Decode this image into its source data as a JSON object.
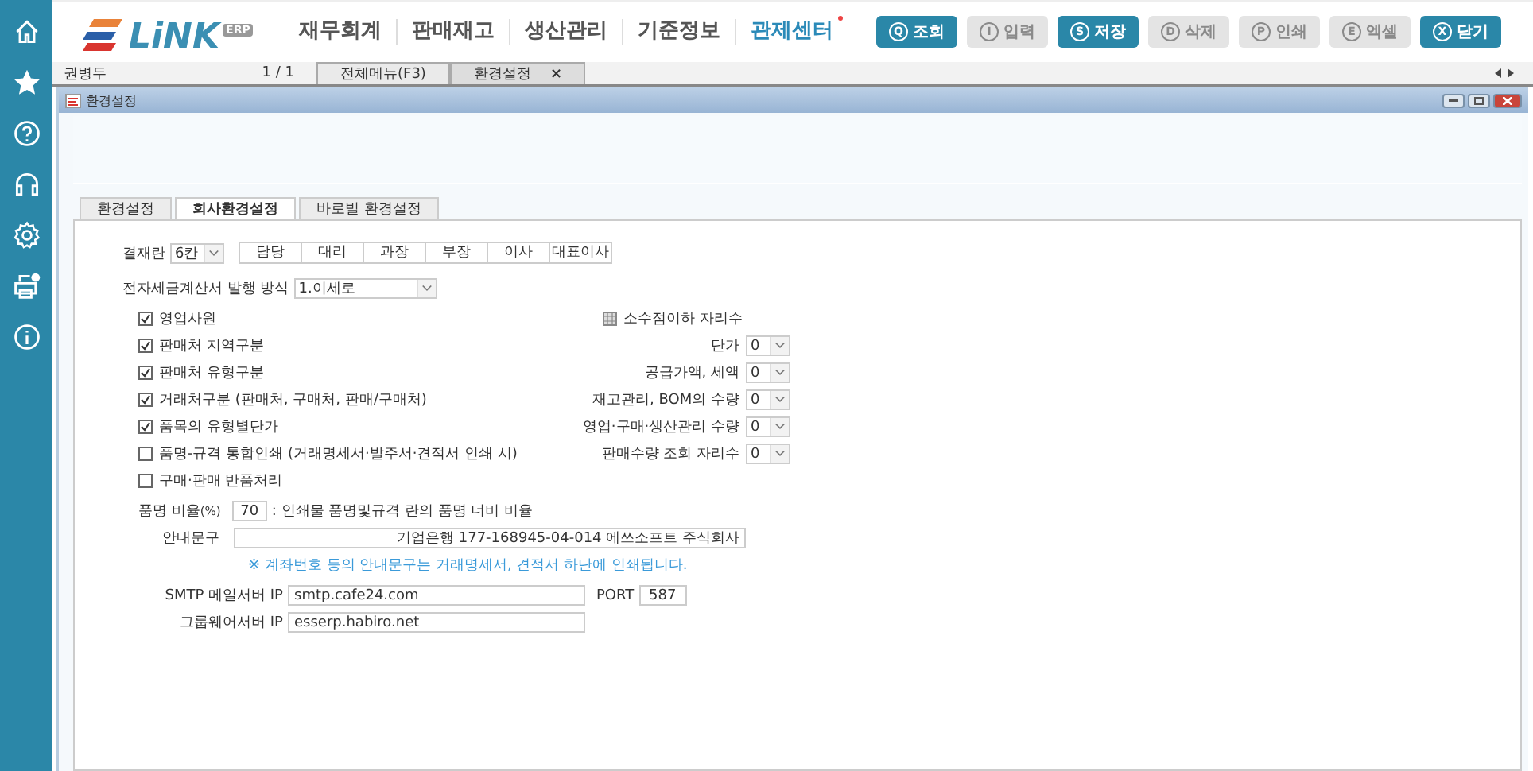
{
  "logo": {
    "text": "LiNK",
    "badge": "ERP"
  },
  "nav": [
    {
      "label": "재무회계",
      "new": false
    },
    {
      "label": "판매재고",
      "new": false
    },
    {
      "label": "생산관리",
      "new": false
    },
    {
      "label": "기준정보",
      "new": false
    },
    {
      "label": "관제센터",
      "new": true
    }
  ],
  "toolbar": [
    {
      "key": "Q",
      "label": "조회",
      "disabled": false
    },
    {
      "key": "I",
      "label": "입력",
      "disabled": true
    },
    {
      "key": "S",
      "label": "저장",
      "disabled": false
    },
    {
      "key": "D",
      "label": "삭제",
      "disabled": true
    },
    {
      "key": "P",
      "label": "인쇄",
      "disabled": true
    },
    {
      "key": "E",
      "label": "엑셀",
      "disabled": true
    },
    {
      "key": "X",
      "label": "닫기",
      "disabled": false
    }
  ],
  "tab_bar": {
    "user": "권병두",
    "page": "1 / 1",
    "tabs": [
      {
        "label": "전체메뉴(F3)",
        "selected": false
      },
      {
        "label": "환경설정",
        "selected": true,
        "close": "×"
      }
    ]
  },
  "window": {
    "title": "환경설정"
  },
  "inner_tabs": [
    {
      "label": "환경설정",
      "selected": false
    },
    {
      "label": "회사환경설정",
      "selected": true
    },
    {
      "label": "바로빌 환경설정",
      "selected": false
    }
  ],
  "approval": {
    "label": "결재란",
    "value": "6칸",
    "slots": [
      "담당",
      "대리",
      "과장",
      "부장",
      "이사",
      "대표이사"
    ]
  },
  "tax_invoice": {
    "label": "전자세금계산서 발행 방식",
    "value": "1.이세로"
  },
  "options": [
    {
      "label": "영업사원",
      "checked": true
    },
    {
      "label": "판매처 지역구분",
      "checked": true
    },
    {
      "label": "판매처 유형구분",
      "checked": true
    },
    {
      "label": "거래처구분 (판매처, 구매처, 판매/구매처)",
      "checked": true
    },
    {
      "label": "품목의 유형별단가",
      "checked": true
    },
    {
      "label": "품명-규격 통합인쇄 (거래명세서·발주서·견적서 인쇄 시)",
      "checked": false
    },
    {
      "label": "구매·판매 반품처리",
      "checked": false
    }
  ],
  "decimals": {
    "title": "소수점이하 자리수",
    "rows": [
      {
        "label": "단가",
        "value": "0"
      },
      {
        "label": "공급가액, 세액",
        "value": "0"
      },
      {
        "label": "재고관리, BOM의 수량",
        "value": "0"
      },
      {
        "label": "영업·구매·생산관리 수량",
        "value": "0"
      },
      {
        "label": "판매수량 조회 자리수",
        "value": "0"
      }
    ]
  },
  "ratio": {
    "label": "품명 비율",
    "unit": "(%)",
    "value": "70",
    "description": ": 인쇄물 품명및규격 란의 품명 너비 비율"
  },
  "notice": {
    "label": "안내문구",
    "value": "기업은행 177-168945-04-014 에쓰소프트 주식회사",
    "hint": "※ 계좌번호 등의 안내문구는 거래명세서, 견적서 하단에 인쇄됩니다."
  },
  "smtp": {
    "label": "SMTP 메일서버 IP",
    "value": "smtp.cafe24.com",
    "port_label": "PORT",
    "port": "587"
  },
  "groupware": {
    "label": "그룹웨어서버 IP",
    "value": "esserp.habiro.net"
  }
}
